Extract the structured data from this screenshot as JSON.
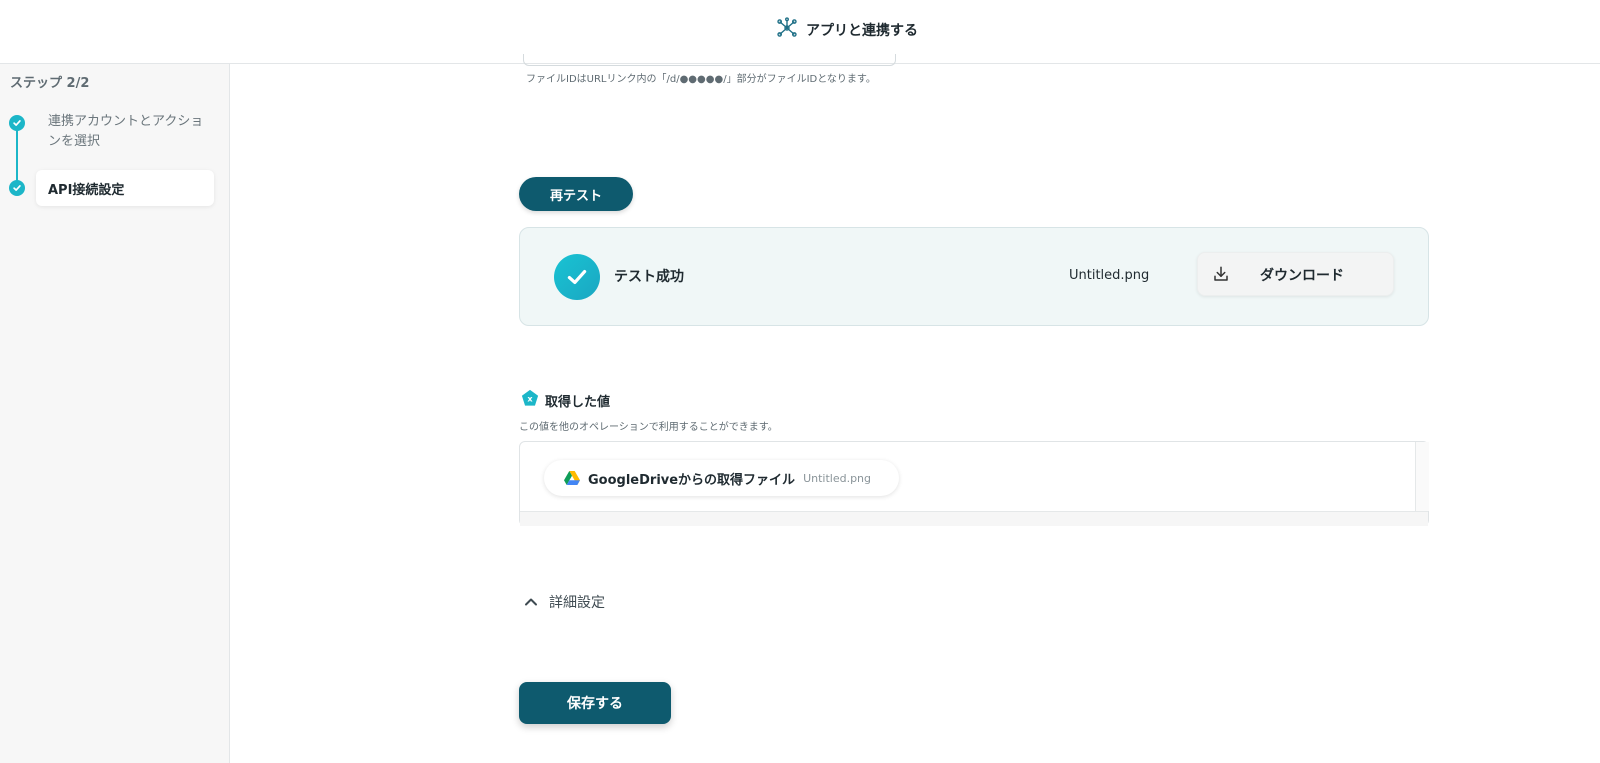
{
  "header": {
    "title": "アプリと連携する",
    "icon": "integration-hub-icon"
  },
  "sidebar": {
    "step_count": "ステップ 2/2",
    "steps": [
      {
        "label": "連携アカウントとアクションを選択",
        "status": "done"
      },
      {
        "label": "API接続設定",
        "status": "active"
      }
    ]
  },
  "main": {
    "file_id_help": "ファイルIDはURLリンク内の「/d/●●●●●/」部分がファイルIDとなります。",
    "retest_label": "再テスト",
    "test_result": {
      "status_text": "テスト成功",
      "file_name": "Untitled.png",
      "download_label": "ダウンロード"
    },
    "acquired": {
      "title": "取得した値",
      "description": "この値を他のオペレーションで利用することができます。",
      "items": [
        {
          "label": "GoogleDriveからの取得ファイル",
          "value": "Untitled.png",
          "icon": "google-drive-icon"
        }
      ]
    },
    "detail_settings_label": "詳細設定",
    "save_label": "保存する"
  },
  "colors": {
    "primary": "#0e5a6e",
    "accent": "#1cb6c8",
    "success_bg": "#f0f7f7"
  }
}
